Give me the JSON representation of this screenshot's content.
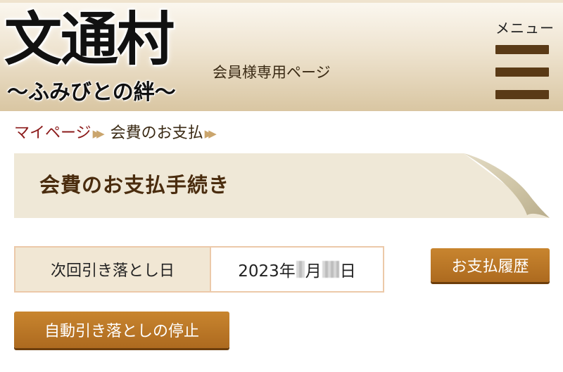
{
  "header": {
    "logo_main": "文通村",
    "logo_sub": "〜ふみびとの絆〜",
    "members_label": "会員様専用ページ",
    "menu_label": "メニュー",
    "menu_icon": "hamburger-icon"
  },
  "breadcrumb": {
    "items": [
      {
        "label": "マイページ"
      },
      {
        "label": "会費のお支払"
      }
    ],
    "separator_icon": "double-chevron-right-icon"
  },
  "page_title": "会費のお支払手続き",
  "billing": {
    "next_debit_label": "次回引き落とし日",
    "date_year": "2023年",
    "date_month_suffix": "月",
    "date_day_suffix": "日"
  },
  "buttons": {
    "history_label": "お支払履歴",
    "stop_autodebit_label": "自動引き落としの停止"
  },
  "colors": {
    "accent_brown": "#ad6a1f",
    "link_red": "#8b1a1a",
    "banner_bg": "#efe8d7",
    "menu_bar": "#5a3a16"
  }
}
